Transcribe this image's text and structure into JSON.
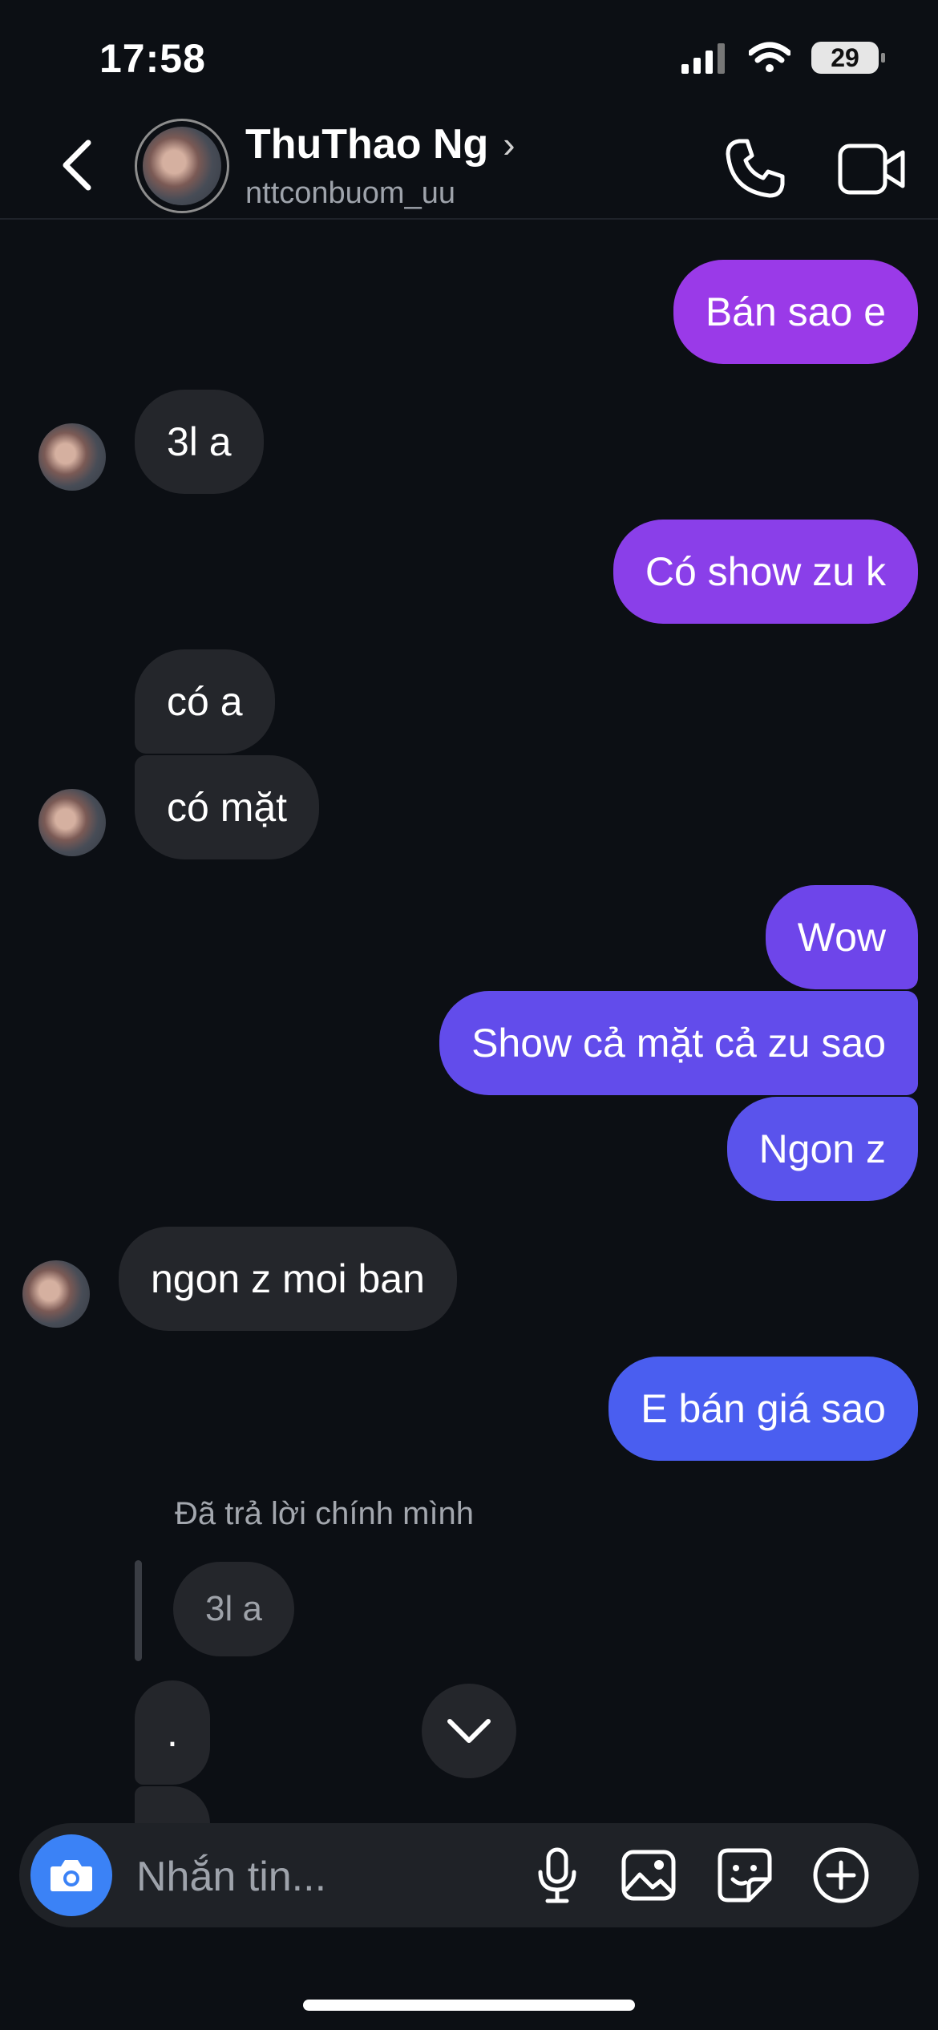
{
  "status_bar": {
    "time": "17:58",
    "battery": "29"
  },
  "header": {
    "name": "ThuThao Ng",
    "username": "nttconbuom_uu"
  },
  "messages": [
    {
      "text": "Bán sao e"
    },
    {
      "text": "3l a"
    },
    {
      "text": "Có show zu k"
    },
    {
      "text": "có a"
    },
    {
      "text": "có mặt"
    },
    {
      "text": "Wow"
    },
    {
      "text": "Show cả mặt cả zu sao"
    },
    {
      "text": "Ngon z"
    },
    {
      "text": "ngon z moi ban"
    },
    {
      "text": "E bán giá sao"
    },
    {
      "text": "."
    },
    {
      "text": "."
    }
  ],
  "reply": {
    "caption": "Đã trả lời chính mình",
    "quoted_text": "3l a"
  },
  "composer": {
    "placeholder": "Nhắn tin..."
  },
  "colors": {
    "outgoing_top": "#9a3ae8",
    "outgoing_bottom": "#4a5ef0",
    "incoming": "#24262b",
    "camera_button": "#3b82f6"
  }
}
